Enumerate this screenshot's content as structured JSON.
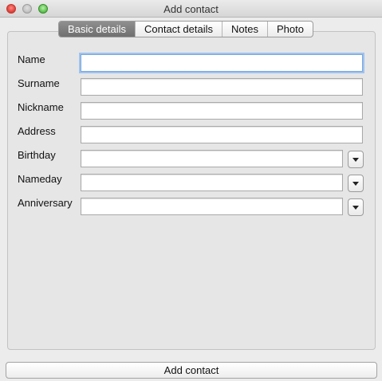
{
  "window": {
    "title": "Add contact"
  },
  "tabs": [
    {
      "label": "Basic details",
      "selected": true
    },
    {
      "label": "Contact details",
      "selected": false
    },
    {
      "label": "Notes",
      "selected": false
    },
    {
      "label": "Photo",
      "selected": false
    }
  ],
  "fields": {
    "name": {
      "label": "Name",
      "value": ""
    },
    "surname": {
      "label": "Surname",
      "value": ""
    },
    "nickname": {
      "label": "Nickname",
      "value": ""
    },
    "address": {
      "label": "Address",
      "value": ""
    },
    "birthday": {
      "label": "Birthday",
      "value": ""
    },
    "nameday": {
      "label": "Nameday",
      "value": ""
    },
    "anniversary": {
      "label": "Anniversary",
      "value": ""
    }
  },
  "footer": {
    "add_label": "Add contact"
  }
}
